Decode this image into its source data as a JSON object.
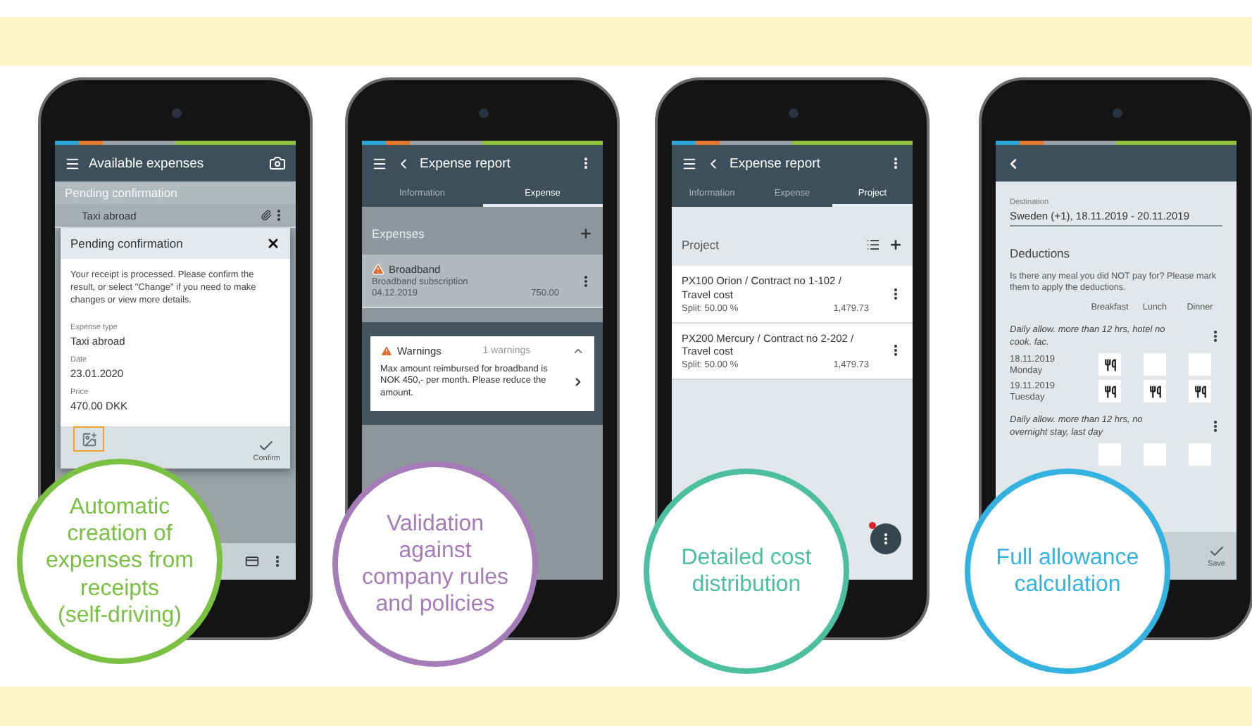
{
  "phones": [
    {
      "kind": "receipt",
      "title": "Available expenses",
      "subtitle": "Pending confirmation",
      "item": "Taxi abroad",
      "dialog": {
        "title": "Pending confirmation",
        "message": "Your receipt is processed. Please confirm the result, or select \"Change\" if you need to make changes or view more details.",
        "fields": [
          {
            "label": "Expense type",
            "value": "Taxi abroad"
          },
          {
            "label": "Date",
            "value": "23.01.2020"
          },
          {
            "label": "Price",
            "value": "470.00 DKK"
          }
        ],
        "confirm": "Confirm"
      }
    },
    {
      "kind": "warnings",
      "title": "Expense report",
      "tabs": [
        {
          "label": "Information",
          "selected": false
        },
        {
          "label": "Expense",
          "selected": true
        }
      ],
      "section": "Expenses",
      "item": {
        "title": "Broadband",
        "subtitle": "Broadband subscription",
        "date": "04.12.2019",
        "amount": "750.00"
      },
      "warning": {
        "title": "Warnings",
        "count": "1 warnings",
        "message": "Max amount reimbursed for broadband is NOK 450,- per month. Please reduce the amount."
      }
    },
    {
      "kind": "project",
      "title": "Expense report",
      "tabs": [
        {
          "label": "Information",
          "selected": false
        },
        {
          "label": "Expense",
          "selected": false
        },
        {
          "label": "Project",
          "selected": true
        }
      ],
      "section": "Project",
      "rows": [
        {
          "title": "PX100 Orion / Contract no 1-102 / Travel cost",
          "split": "Split: 50.00 %",
          "amount": "1,479.73"
        },
        {
          "title": "PX200 Mercury / Contract no 2-202 / Travel cost",
          "split": "Split: 50.00 %",
          "amount": "1,479.73"
        }
      ]
    },
    {
      "kind": "allowance",
      "destination_label": "Destination",
      "destination": "Sweden (+1), 18.11.2019 - 20.11.2019",
      "heading": "Deductions",
      "hint": "Is there any meal you did NOT pay for? Please mark them to apply the deductions.",
      "columns": [
        "Breakfast",
        "Lunch",
        "Dinner"
      ],
      "groups": [
        {
          "title": "Daily allow. more than 12 hrs, hotel no cook. fac.",
          "days": [
            {
              "date": "18.11.2019",
              "weekday": "Monday",
              "meals": [
                {
                  "checked": true
                },
                {
                  "checked": false
                },
                {
                  "checked": false
                }
              ]
            },
            {
              "date": "19.11.2019",
              "weekday": "Tuesday",
              "meals": [
                {
                  "checked": true
                },
                {
                  "checked": true
                },
                {
                  "checked": true
                }
              ]
            }
          ]
        },
        {
          "title": "Daily allow. more than 12 hrs, no overnight stay, last day",
          "days": [
            {
              "meals": [
                {
                  "checked": false
                },
                {
                  "checked": false
                },
                {
                  "checked": false
                }
              ]
            }
          ]
        }
      ],
      "save": "Save"
    }
  ],
  "features": [
    {
      "text": "Automatic creation of expenses from receipts (self-driving)",
      "color": "#7ac143"
    },
    {
      "text": "Validation against company rules and policies",
      "color": "#a57cb8"
    },
    {
      "text": "Detailed cost distribution",
      "color": "#4cc09e"
    },
    {
      "text": "Full allowance calculation",
      "color": "#35b3e0"
    }
  ]
}
